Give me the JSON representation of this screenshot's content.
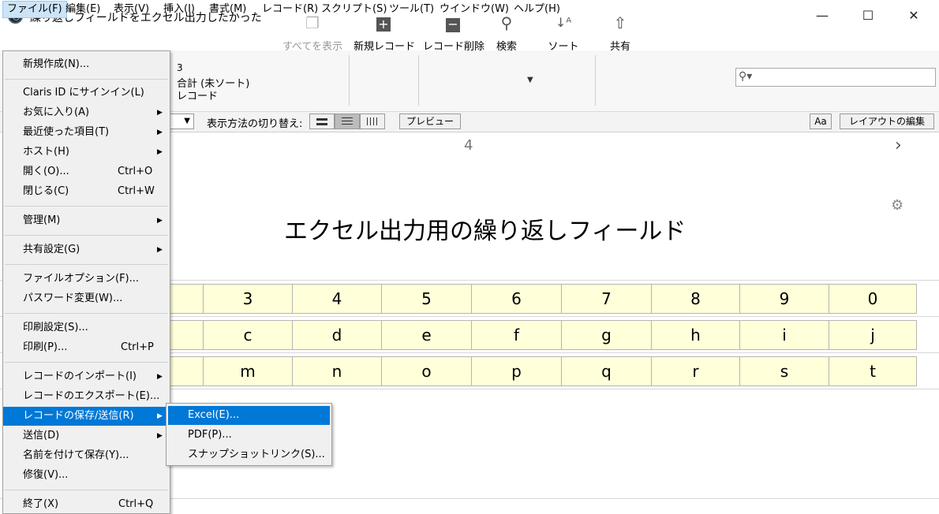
{
  "window": {
    "title": "繰り返しフィールドをエクセル出力したかった"
  },
  "menubar": [
    "ファイル(F)",
    "編集(E)",
    "表示(V)",
    "挿入(I)",
    "書式(M)",
    "レコード(R)",
    "スクリプト(S)",
    "ツール(T)",
    "ウインドウ(W)",
    "ヘルプ(H)"
  ],
  "toolbar": {
    "record_count": "3",
    "total_label": "合計 (未ソート)",
    "record_word": "レコード",
    "show_all": "すべてを表示",
    "new_record": "新規レコード",
    "delete_record": "レコード削除",
    "find": "検索",
    "sort": "ソート",
    "share": "共有"
  },
  "layoutbar": {
    "view_as_label": "表示方法の切り替え:",
    "preview": "プレビュー",
    "text_size": "Aa",
    "edit_layout": "レイアウトの編集"
  },
  "content": {
    "record_number": "4",
    "layout_title": "エクセル出力用の繰り返しフィールド",
    "rows": [
      [
        "3",
        "4",
        "5",
        "6",
        "7",
        "8",
        "9",
        "0"
      ],
      [
        "c",
        "d",
        "e",
        "f",
        "g",
        "h",
        "i",
        "j"
      ],
      [
        "m",
        "n",
        "o",
        "p",
        "q",
        "r",
        "s",
        "t"
      ]
    ]
  },
  "file_menu": [
    {
      "label": "新規作成(N)...",
      "shortcut": "",
      "submenu": false
    },
    {
      "label": "Claris ID にサインイン(L)",
      "shortcut": "",
      "submenu": false
    },
    {
      "label": "お気に入り(A)",
      "shortcut": "",
      "submenu": true
    },
    {
      "label": "最近使った項目(T)",
      "shortcut": "",
      "submenu": true
    },
    {
      "label": "ホスト(H)",
      "shortcut": "",
      "submenu": true
    },
    {
      "label": "開く(O)...",
      "shortcut": "Ctrl+O",
      "submenu": false
    },
    {
      "label": "閉じる(C)",
      "shortcut": "Ctrl+W",
      "submenu": false
    },
    {
      "label": "管理(M)",
      "shortcut": "",
      "submenu": true
    },
    {
      "label": "共有設定(G)",
      "shortcut": "",
      "submenu": true
    },
    {
      "label": "ファイルオプション(F)...",
      "shortcut": "",
      "submenu": false
    },
    {
      "label": "パスワード変更(W)...",
      "shortcut": "",
      "submenu": false
    },
    {
      "label": "印刷設定(S)...",
      "shortcut": "",
      "submenu": false
    },
    {
      "label": "印刷(P)...",
      "shortcut": "Ctrl+P",
      "submenu": false
    },
    {
      "label": "レコードのインポート(I)",
      "shortcut": "",
      "submenu": true
    },
    {
      "label": "レコードのエクスポート(E)...",
      "shortcut": "",
      "submenu": false
    },
    {
      "label": "レコードの保存/送信(R)",
      "shortcut": "",
      "submenu": true
    },
    {
      "label": "送信(D)",
      "shortcut": "",
      "submenu": true
    },
    {
      "label": "名前を付けて保存(Y)...",
      "shortcut": "",
      "submenu": false
    },
    {
      "label": "修復(V)...",
      "shortcut": "",
      "submenu": false
    },
    {
      "label": "終了(X)",
      "shortcut": "Ctrl+Q",
      "submenu": false
    }
  ],
  "save_send_submenu": [
    "Excel(E)...",
    "PDF(P)...",
    "スナップショットリンク(S)..."
  ]
}
